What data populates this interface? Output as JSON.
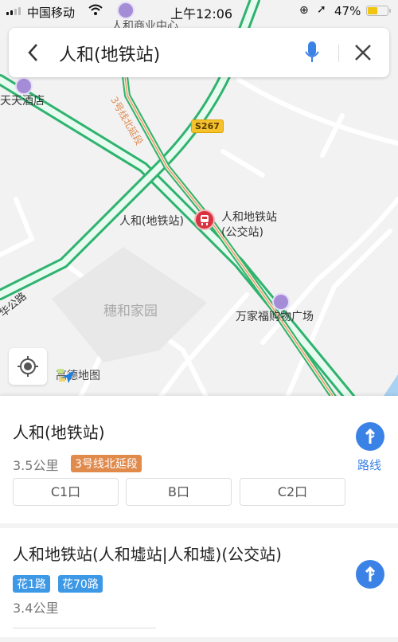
{
  "status_bar": {
    "carrier": "中国移动",
    "time": "上午12:06",
    "battery_percent": "47%",
    "battery_level": 0.47,
    "icons": [
      "signal-icon",
      "wifi-icon",
      "orientation-lock-icon",
      "location-arrow-icon",
      "battery-icon"
    ]
  },
  "search": {
    "query": "人和(地铁站)",
    "back_icon": "chevron-left-icon",
    "mic_icon": "microphone-icon",
    "close_icon": "close-icon"
  },
  "map": {
    "labels": {
      "commerce_center": "人和商业中心",
      "hotel": "天天酒店",
      "metro_line": "3号线北延段",
      "road_badge": "S267",
      "metro_station": "人和(地铁站)",
      "bus_station_line1": "人和地铁站",
      "bus_station_line2": "(公交站)",
      "road_west": "华公路",
      "community": "穗和家园",
      "mall": "万家福购物广场",
      "logo": "高德地图"
    },
    "colors": {
      "road_green": "#2fb36f",
      "metro_line": "#e0894c",
      "station_red": "#d9333f",
      "poi_purple": "#a48cd6"
    }
  },
  "results": [
    {
      "title": "人和(地铁站)",
      "distance": "3.5公里",
      "tag": "3号线北延段",
      "tag_color": "#e08a4c",
      "exits": [
        "C1口",
        "B口",
        "C2口"
      ],
      "route_label": "路线"
    },
    {
      "title": "人和地铁站(人和墟站|人和墟)(公交站)",
      "tags": [
        "花1路",
        "花70路"
      ],
      "tag_color": "#3d99e6",
      "distance": "3.4公里"
    }
  ]
}
